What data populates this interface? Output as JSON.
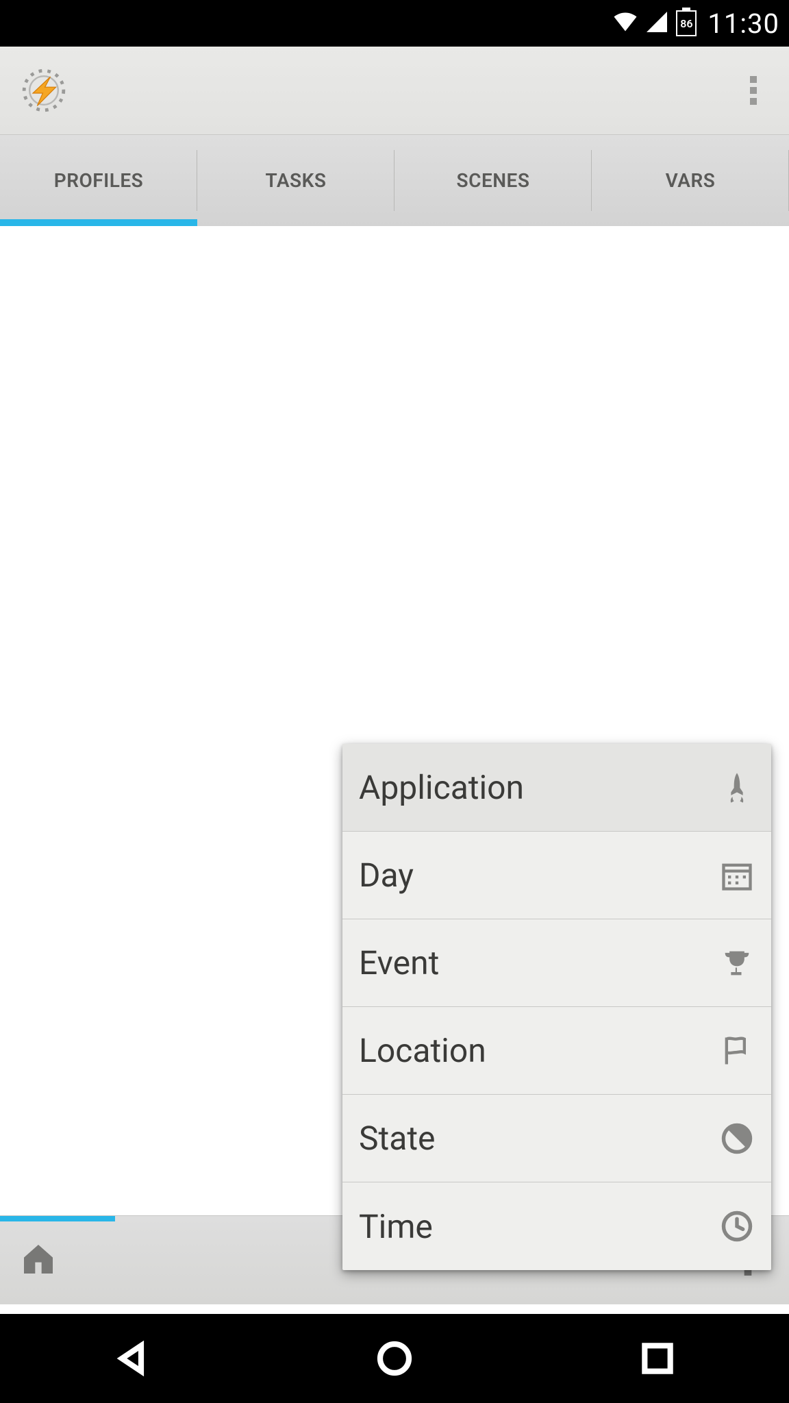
{
  "status_bar": {
    "battery_level": "86",
    "clock": "11:30"
  },
  "tabs": {
    "items": [
      {
        "label": "PROFILES"
      },
      {
        "label": "TASKS"
      },
      {
        "label": "SCENES"
      },
      {
        "label": "VARS"
      }
    ],
    "active_index": 0
  },
  "context_menu": {
    "items": [
      {
        "label": "Application",
        "icon": "rocket-icon",
        "highlighted": true
      },
      {
        "label": "Day",
        "icon": "calendar-icon",
        "highlighted": false
      },
      {
        "label": "Event",
        "icon": "trophy-icon",
        "highlighted": false
      },
      {
        "label": "Location",
        "icon": "flag-icon",
        "highlighted": false
      },
      {
        "label": "State",
        "icon": "contrast-icon",
        "highlighted": false
      },
      {
        "label": "Time",
        "icon": "clock-icon",
        "highlighted": false
      }
    ]
  },
  "colors": {
    "accent": "#29b6e8"
  }
}
